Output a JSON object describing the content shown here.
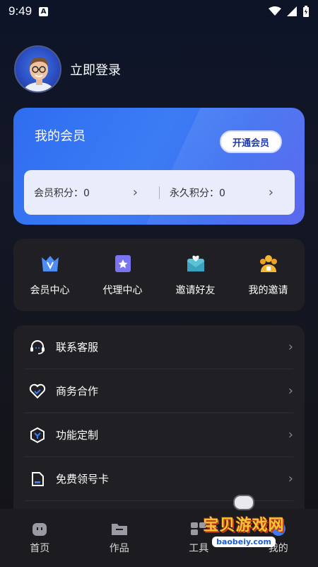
{
  "status": {
    "time": "9:49",
    "a_badge": "A"
  },
  "profile": {
    "login_label": "立即登录"
  },
  "vip": {
    "title": "我的会员",
    "open_button": "开通会员",
    "member_points_label": "会员积分：0",
    "permanent_points_label": "永久积分：0"
  },
  "quick": [
    {
      "label": "会员中心",
      "icon": "vip-crown-icon"
    },
    {
      "label": "代理中心",
      "icon": "agent-star-icon"
    },
    {
      "label": "邀请好友",
      "icon": "invite-envelope-icon"
    },
    {
      "label": "我的邀请",
      "icon": "people-icon"
    }
  ],
  "menu": [
    {
      "label": "联系客服",
      "icon": "headset-icon"
    },
    {
      "label": "商务合作",
      "icon": "handshake-icon"
    },
    {
      "label": "功能定制",
      "icon": "hexagon-icon"
    },
    {
      "label": "免费领号卡",
      "icon": "sim-card-icon"
    }
  ],
  "tabs": [
    {
      "label": "首页",
      "icon": "home-icon"
    },
    {
      "label": "作品",
      "icon": "folder-icon"
    },
    {
      "label": "工具",
      "icon": "tools-icon"
    },
    {
      "label": "我的",
      "icon": "profile-icon"
    }
  ],
  "watermark": {
    "title": "宝贝游戏网",
    "url": "baobeiy.com"
  },
  "colors": {
    "accent": "#3b7cf5",
    "card_bg": "#1f1f24",
    "gold": "#f6c334"
  }
}
